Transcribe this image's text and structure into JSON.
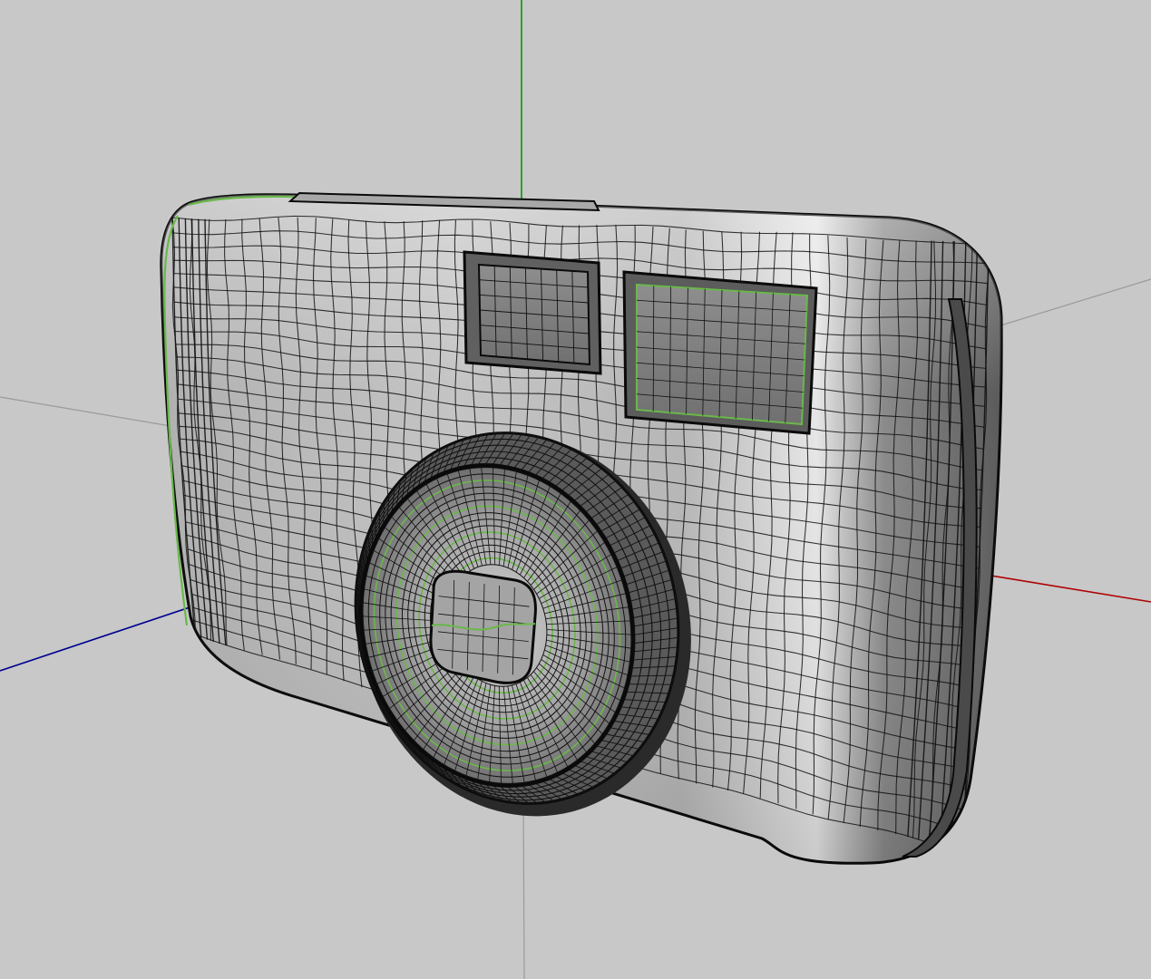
{
  "viewport": {
    "kind": "3d-perspective-viewport",
    "render_mode": "wireframe-shaded",
    "background_color": "#c8c8c8",
    "axes": {
      "x_color": "#b00000",
      "y_color": "#009a00",
      "z_color": "#000090",
      "x_negative_color": "#9a9a9a",
      "y_negative_color": "#9a9a9a"
    }
  },
  "object": {
    "name": "camera-model",
    "shade_color": "#b4b4b4",
    "highlight_color": "#ececec",
    "wire_color": "#111111",
    "edge_highlight_color": "#6ab84a",
    "parts": [
      "camera-body",
      "viewfinder-window",
      "flash-window",
      "lens-barrel",
      "lens-glass"
    ]
  }
}
